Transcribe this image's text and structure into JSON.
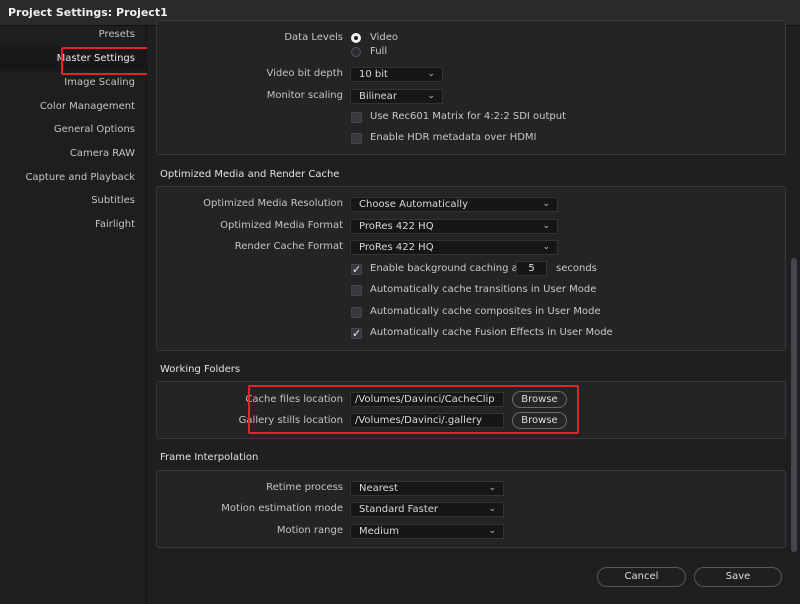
{
  "window": {
    "title": "Project Settings:  Project1"
  },
  "sidebar": {
    "items": [
      {
        "label": "Presets"
      },
      {
        "label": "Master Settings"
      },
      {
        "label": "Image Scaling"
      },
      {
        "label": "Color Management"
      },
      {
        "label": "General Options"
      },
      {
        "label": "Camera RAW"
      },
      {
        "label": "Capture and Playback"
      },
      {
        "label": "Subtitles"
      },
      {
        "label": "Fairlight"
      }
    ],
    "selected": "Master Settings"
  },
  "video_monitoring": {
    "data_levels": {
      "label": "Data Levels",
      "options": [
        "Video",
        "Full"
      ],
      "selected": "Video"
    },
    "video_bit_depth": {
      "label": "Video bit depth",
      "value": "10 bit"
    },
    "monitor_scaling": {
      "label": "Monitor scaling",
      "value": "Bilinear"
    },
    "rec601": {
      "label": "Use Rec601 Matrix for 4:2:2 SDI output",
      "checked": false
    },
    "hdr_metadata": {
      "label": "Enable HDR metadata over HDMI",
      "checked": false
    }
  },
  "optimized_media": {
    "title": "Optimized Media and Render Cache",
    "resolution": {
      "label": "Optimized Media Resolution",
      "value": "Choose Automatically"
    },
    "format": {
      "label": "Optimized Media Format",
      "value": "ProRes 422 HQ"
    },
    "render_cache_format": {
      "label": "Render Cache Format",
      "value": "ProRes 422 HQ"
    },
    "background_caching": {
      "label": "Enable background caching after",
      "value": "5",
      "unit": "seconds",
      "checked": true
    },
    "cache_transitions": {
      "label": "Automatically cache transitions in User Mode",
      "checked": false
    },
    "cache_composites": {
      "label": "Automatically cache composites in User Mode",
      "checked": false
    },
    "cache_fusion": {
      "label": "Automatically cache Fusion Effects in User Mode",
      "checked": true
    }
  },
  "working_folders": {
    "title": "Working Folders",
    "cache_files": {
      "label": "Cache files location",
      "value": "/Volumes/Davinci/CacheClip",
      "button": "Browse"
    },
    "gallery_stills": {
      "label": "Gallery stills location",
      "value": "/Volumes/Davinci/.gallery",
      "button": "Browse"
    }
  },
  "frame_interpolation": {
    "title": "Frame Interpolation",
    "retime_process": {
      "label": "Retime process",
      "value": "Nearest"
    },
    "motion_estimation": {
      "label": "Motion estimation mode",
      "value": "Standard Faster"
    },
    "motion_range": {
      "label": "Motion range",
      "value": "Medium"
    }
  },
  "footer": {
    "cancel": "Cancel",
    "save": "Save"
  },
  "icons": {
    "dropdown": "chevron-down-icon",
    "check": "checkmark-icon"
  },
  "colors": {
    "highlight": "#e0242b",
    "background": "#1f1f22"
  }
}
